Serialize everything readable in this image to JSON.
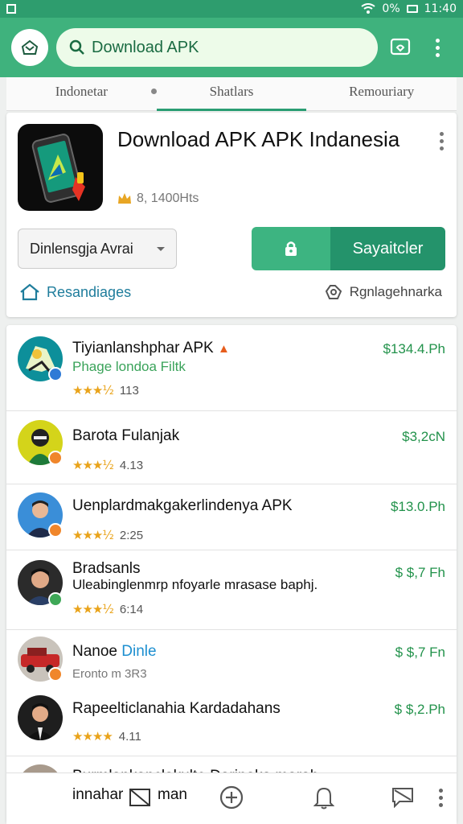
{
  "status_bar": {
    "signal": "0%",
    "time": "11:40"
  },
  "search": {
    "value": "Download APK"
  },
  "tabs": [
    {
      "label": "Indonetar"
    },
    {
      "label": "Shatlars"
    },
    {
      "label": "Remouriary"
    }
  ],
  "app": {
    "title": "Download APK APK Indanesia",
    "meta": "8, 1400Hts",
    "version_select": "Dinlensgja Avrai",
    "download_label": "Sayaitcler",
    "link_left": "Resandiages",
    "link_right": "Rgnlagehnarka"
  },
  "list": [
    {
      "name": "Tiyianlanshphar APK",
      "sub": "Phage londoa Filtk",
      "rating_text": "113",
      "stars": "★★★½",
      "price": "$134.4.Ph"
    },
    {
      "name": "Barota Fulanjak",
      "rating_text": "4.13",
      "stars": "★★★½",
      "price": "$3,2cN"
    },
    {
      "name": "Uenplardmakgakerlindenya APK",
      "rating_text": "2:25",
      "stars": "★★★½",
      "price": "$13.0.Ph"
    },
    {
      "name": "Bradsanls",
      "sub": "Uleabinglenmrp nfoyarle mrasase baphj.",
      "rating_text": "6:14",
      "stars": "★★★½",
      "price": "$ $,7 Fh"
    },
    {
      "name": "Nanoe",
      "name_tag": "Dinle",
      "sub": "Eronto m 3R3",
      "price": "$ $,7 Fn"
    },
    {
      "name": "Rapeelticlanahia Kardadahans",
      "rating_text": "4.11",
      "stars": "★★★★",
      "price": "$ $,2.Ph"
    },
    {
      "name": "Burmlankanclakulte Darinaka marah",
      "sub": "innahar",
      "sub_tail": "man"
    }
  ],
  "colors": {
    "primary": "#3fb27d",
    "dark_green": "#24936b",
    "star": "#e9a31a",
    "price": "#22924b"
  },
  "icons": [
    "home-icon",
    "search-icon",
    "cast-icon",
    "more-icon",
    "lock-icon",
    "share-icon",
    "settings-icon",
    "add-icon",
    "bell-icon",
    "message-icon"
  ]
}
